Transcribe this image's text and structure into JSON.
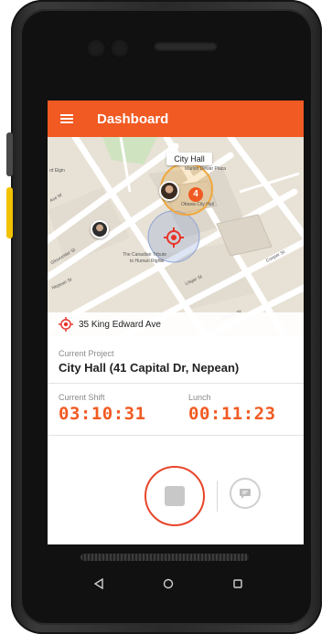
{
  "appbar": {
    "title": "Dashboard"
  },
  "map": {
    "popup_label": "City Hall",
    "cluster_count": "4",
    "labels": {
      "city_hall_small": "Marion Dewar Plaza",
      "elgin": "rd Elgin",
      "ave_w": "Ave W",
      "ottawa_city_hall": "Ottawa City Hall",
      "gloucester": "Gloucester St",
      "canadian_tribute": "The Canadian Tribute",
      "human_rights": "to Human Rights",
      "nepean": "Nepean St",
      "lisgar": "Lisgar St",
      "cooper": "Cooper St",
      "cooper2": "Cooper St"
    },
    "address": "35 King Edward Ave"
  },
  "project": {
    "label": "Current Project",
    "name": "City Hall (41 Capital Dr, Nepean)"
  },
  "shift": {
    "label": "Current Shift",
    "time": "03:10:31"
  },
  "lunch": {
    "label": "Lunch",
    "time": "00:11:23"
  },
  "colors": {
    "brand": "#f15a22",
    "stop_ring": "#e8452b"
  },
  "icons": [
    "menu-icon",
    "target-location-icon",
    "stop-icon",
    "message-icon",
    "back-icon",
    "home-icon",
    "recents-icon"
  ]
}
